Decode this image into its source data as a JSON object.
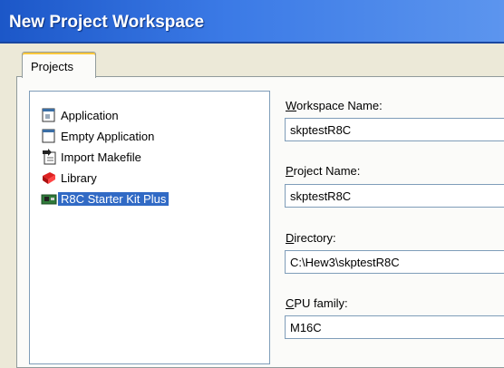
{
  "window": {
    "title": "New Project Workspace"
  },
  "tabs": [
    {
      "label": "Projects"
    }
  ],
  "project_types": [
    {
      "label": "Application",
      "icon": "application-icon",
      "selected": false
    },
    {
      "label": "Empty Application",
      "icon": "empty-application-icon",
      "selected": false
    },
    {
      "label": "Import Makefile",
      "icon": "import-makefile-icon",
      "selected": false
    },
    {
      "label": "Library",
      "icon": "library-icon",
      "selected": false
    },
    {
      "label": "R8C Starter Kit Plus",
      "icon": "starter-kit-icon",
      "selected": true
    }
  ],
  "fields": {
    "workspace_name": {
      "label_key": "W",
      "label_rest": "orkspace Name:",
      "value": "skptestR8C"
    },
    "project_name": {
      "label_key": "P",
      "label_rest": "roject Name:",
      "value": "skptestR8C"
    },
    "directory": {
      "label_key": "D",
      "label_rest": "irectory:",
      "value": "C:\\Hew3\\skptestR8C"
    },
    "cpu_family": {
      "label_key": "C",
      "label_rest": "PU family:",
      "value": "M16C"
    }
  },
  "colors": {
    "titlebar": "#1c57c8",
    "selection": "#316ac5",
    "dialog_bg": "#ece9d8"
  }
}
